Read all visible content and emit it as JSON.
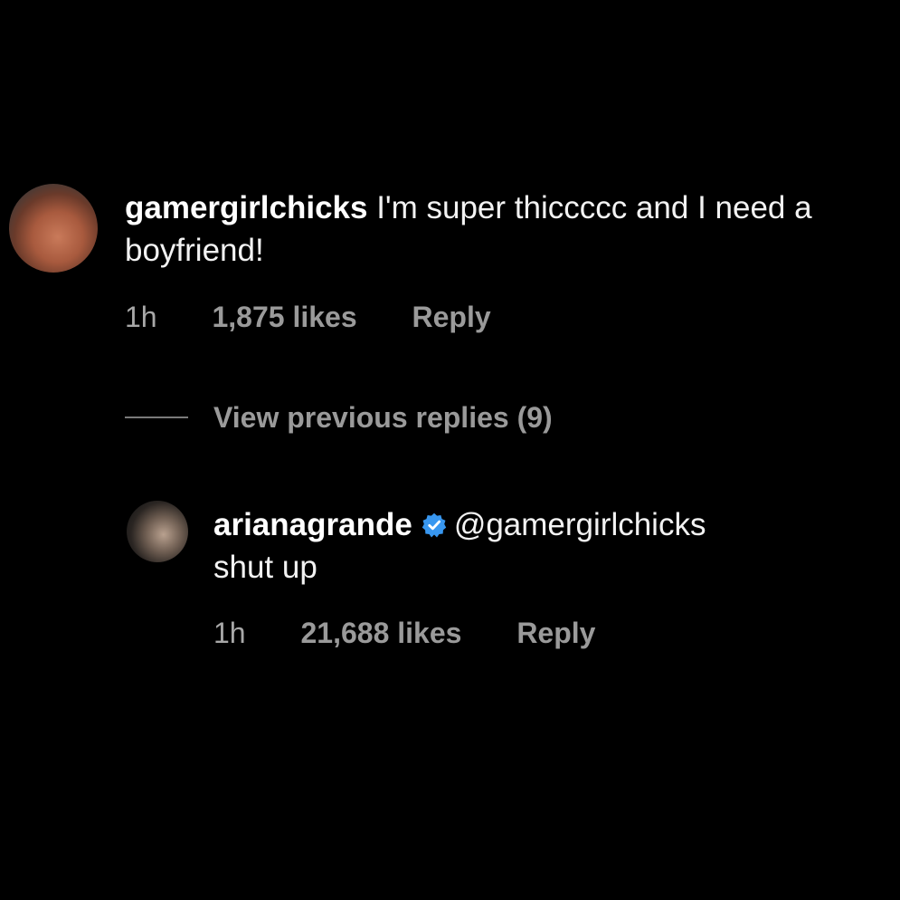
{
  "comments": [
    {
      "username": "gamergirlchicks",
      "text": " I'm super thiccccc and I need a boyfriend!",
      "time": "1h",
      "likes": "1,875 likes",
      "reply_label": "Reply"
    },
    {
      "username": "arianagrande",
      "verified": true,
      "mention": "@gamergirlchicks",
      "text": "shut up",
      "time": "1h",
      "likes": "21,688 likes",
      "reply_label": "Reply"
    }
  ],
  "view_previous_replies": "View previous replies (9)",
  "colors": {
    "background": "#000000",
    "text": "#f2f2f2",
    "muted": "#9a9a9a",
    "verified": "#3897f0"
  }
}
